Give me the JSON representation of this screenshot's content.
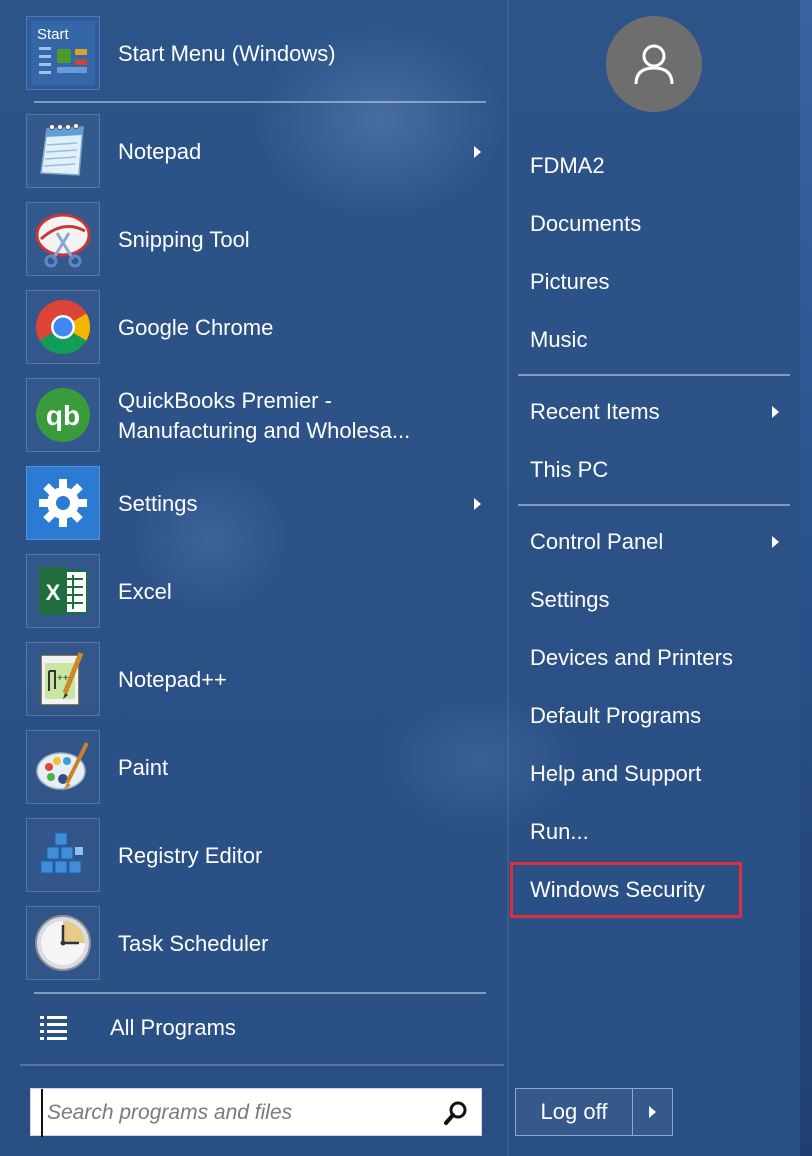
{
  "pinned": {
    "label": "Start Menu (Windows)",
    "icon": "start-menu-app-icon",
    "icon_text": "Start"
  },
  "programs": [
    {
      "label": "Notepad",
      "icon": "notepad-icon",
      "has_submenu": true
    },
    {
      "label": "Snipping Tool",
      "icon": "snipping-tool-icon",
      "has_submenu": false
    },
    {
      "label": "Google Chrome",
      "icon": "chrome-icon",
      "has_submenu": false
    },
    {
      "label_line1": "QuickBooks Premier -",
      "label_line2": "Manufacturing and Wholesa...",
      "icon": "quickbooks-icon",
      "icon_text": "qb",
      "has_submenu": false
    },
    {
      "label": "Settings",
      "icon": "settings-gear-icon",
      "has_submenu": true
    },
    {
      "label": "Excel",
      "icon": "excel-icon",
      "icon_text": "X",
      "has_submenu": false
    },
    {
      "label": "Notepad++",
      "icon": "notepad-plus-plus-icon",
      "has_submenu": false
    },
    {
      "label": "Paint",
      "icon": "paint-palette-icon",
      "has_submenu": false
    },
    {
      "label": "Registry Editor",
      "icon": "registry-editor-icon",
      "has_submenu": false
    },
    {
      "label": "Task Scheduler",
      "icon": "task-scheduler-clock-icon",
      "has_submenu": false
    }
  ],
  "all_programs": {
    "label": "All Programs",
    "icon": "list-icon"
  },
  "search": {
    "placeholder": "Search programs and files",
    "value": "",
    "icon": "search-icon"
  },
  "user": {
    "icon": "user-avatar-icon"
  },
  "right_menu": {
    "group1": [
      "FDMA2",
      "Documents",
      "Pictures",
      "Music"
    ],
    "group2": [
      {
        "label": "Recent Items",
        "has_submenu": true
      },
      {
        "label": "This PC",
        "has_submenu": false
      }
    ],
    "group3": [
      {
        "label": "Control Panel",
        "has_submenu": true
      },
      {
        "label": "Settings",
        "has_submenu": false
      },
      {
        "label": "Devices and Printers",
        "has_submenu": false
      },
      {
        "label": "Default Programs",
        "has_submenu": false
      },
      {
        "label": "Help and Support",
        "has_submenu": false
      },
      {
        "label": "Run...",
        "has_submenu": false
      },
      {
        "label": "Windows Security",
        "has_submenu": false,
        "highlighted": true
      }
    ]
  },
  "power": {
    "label": "Log off",
    "more_icon": "chevron-right-icon"
  },
  "colors": {
    "background": "#2b5188",
    "text": "#ffffff",
    "highlight_border": "#d9323d",
    "avatar": "#6e6e6e"
  }
}
